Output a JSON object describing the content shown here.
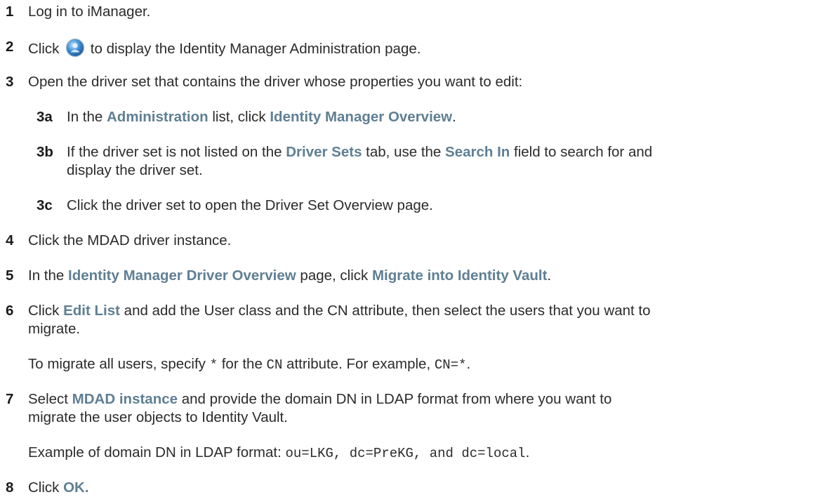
{
  "steps": [
    {
      "num": "1",
      "parts": [
        {
          "t": "Log in to iManager."
        }
      ]
    },
    {
      "num": "2",
      "parts": [
        {
          "t": "Click "
        },
        {
          "icon": "identity-manager-globe-icon"
        },
        {
          "t": " to display the Identity Manager Administration page."
        }
      ]
    },
    {
      "num": "3",
      "parts": [
        {
          "t": "Open the driver set that contains the driver whose properties you want to edit:"
        }
      ]
    },
    {
      "num": "3a",
      "parts": [
        {
          "t": "In the "
        },
        {
          "ui": "Administration"
        },
        {
          "t": " list, click "
        },
        {
          "ui": "Identity Manager Overview"
        },
        {
          "t": "."
        }
      ]
    },
    {
      "num": "3b",
      "parts": [
        {
          "t": "If the driver set is not listed on the "
        },
        {
          "ui": "Driver Sets"
        },
        {
          "t": " tab, use the "
        },
        {
          "ui": "Search In"
        },
        {
          "t": " field to search for and"
        }
      ]
    },
    {
      "num": "",
      "parts": [
        {
          "t": "display the driver set."
        }
      ]
    },
    {
      "num": "3c",
      "parts": [
        {
          "t": "Click the driver set to open the Driver Set Overview page."
        }
      ]
    },
    {
      "num": "4",
      "parts": [
        {
          "t": "Click the MDAD driver instance."
        }
      ]
    },
    {
      "num": "5",
      "parts": [
        {
          "t": "In the "
        },
        {
          "ui": "Identity Manager Driver Overview"
        },
        {
          "t": " page, click "
        },
        {
          "ui": "Migrate into Identity Vault"
        },
        {
          "t": "."
        }
      ]
    },
    {
      "num": "6",
      "parts": [
        {
          "t": "Click "
        },
        {
          "ui": "Edit List"
        },
        {
          "t": " and add the User class and the CN attribute, then select the users that you want to"
        }
      ]
    },
    {
      "num": "",
      "parts": [
        {
          "t": "migrate."
        }
      ]
    },
    {
      "num": "",
      "parts": [
        {
          "t": "To migrate all users, specify "
        },
        {
          "code": "*"
        },
        {
          "t": " for the "
        },
        {
          "code": "CN"
        },
        {
          "t": " attribute. For example, "
        },
        {
          "code": "CN=*"
        },
        {
          "t": "."
        }
      ]
    },
    {
      "num": "7",
      "parts": [
        {
          "t": "Select "
        },
        {
          "ui": "MDAD instance"
        },
        {
          "t": " and provide the domain DN in LDAP format from where you want to"
        }
      ]
    },
    {
      "num": "",
      "parts": [
        {
          "t": "migrate the user objects to Identity Vault."
        }
      ]
    },
    {
      "num": "",
      "parts": [
        {
          "t": "Example of domain DN in LDAP format: "
        },
        {
          "code": "ou=LKG, dc=PreKG, and dc=local"
        },
        {
          "t": "."
        }
      ]
    },
    {
      "num": "8",
      "parts": [
        {
          "t": "Click "
        },
        {
          "ui": "OK."
        }
      ]
    }
  ],
  "colors": {
    "text": "#2b2b2b",
    "ui_label": "#5f7f93",
    "icon_blue": "#3f8fd2"
  }
}
